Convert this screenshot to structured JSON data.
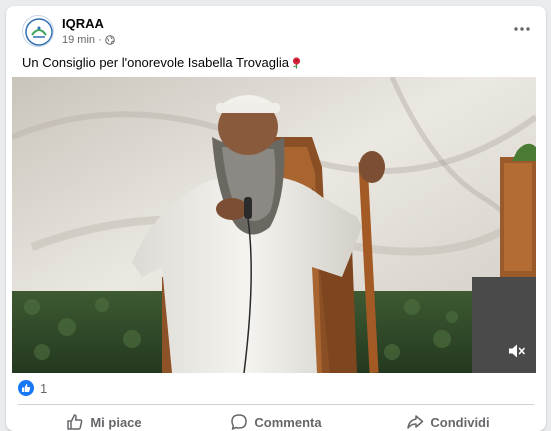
{
  "post": {
    "page_name": "IQRAA",
    "time": "19 min",
    "separator": "·",
    "text": "Un Consiglio per l'onorevole Isabella Trovaglia"
  },
  "icons": {
    "avatar": "iqraa-logo-icon",
    "privacy": "globe-icon",
    "more": "more-options-icon",
    "emoji": "rose-icon",
    "mute": "speaker-muted-icon",
    "reaction": "like-icon"
  },
  "reactions": {
    "count": "1"
  },
  "actions": {
    "like": "Mi piace",
    "comment": "Commenta",
    "share": "Condividi"
  },
  "colors": {
    "accent": "#1877f2",
    "muted_text": "#65676b"
  }
}
